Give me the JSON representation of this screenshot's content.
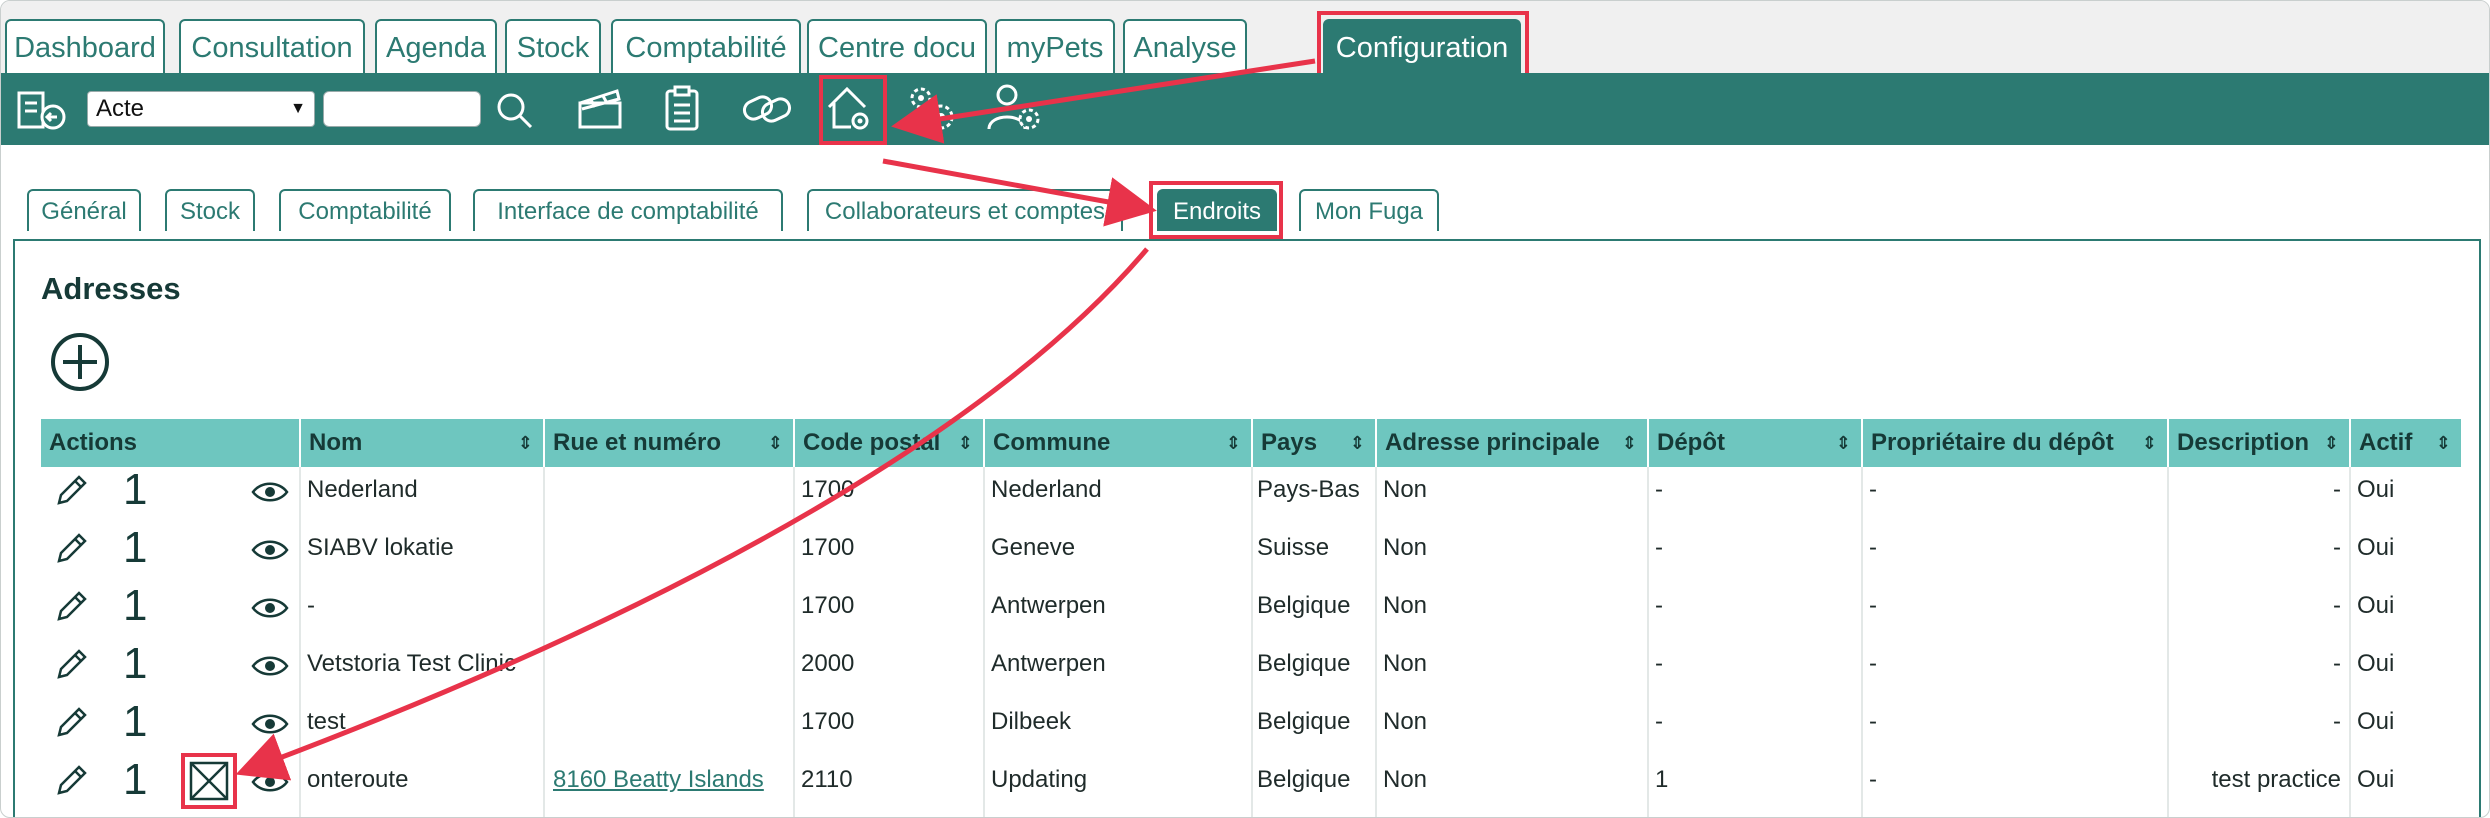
{
  "top_tabs": [
    {
      "label": "Dashboard"
    },
    {
      "label": "Consultation"
    },
    {
      "label": "Agenda"
    },
    {
      "label": "Stock"
    },
    {
      "label": "Comptabilité"
    },
    {
      "label": "Centre docu"
    },
    {
      "label": "myPets"
    },
    {
      "label": "Analyse"
    },
    {
      "label": "Configuration"
    }
  ],
  "toolbar": {
    "select_value": "Acte",
    "search_value": ""
  },
  "sub_tabs": [
    {
      "label": "Général"
    },
    {
      "label": "Stock"
    },
    {
      "label": "Comptabilité"
    },
    {
      "label": "Interface de comptabilité"
    },
    {
      "label": "Collaborateurs et comptes"
    },
    {
      "label": "Endroits"
    },
    {
      "label": "Mon Fuga"
    }
  ],
  "section_title": "Adresses",
  "table": {
    "headers": [
      "Actions",
      "Nom",
      "Rue et numéro",
      "Code postal",
      "Commune",
      "Pays",
      "Adresse principale",
      "Dépôt",
      "Propriétaire du dépôt",
      "Description",
      "Actif"
    ],
    "rows": [
      {
        "count": "1",
        "nom": "Nederland",
        "rue": "",
        "cp": "1700",
        "commune": "Nederland",
        "pays": "Pays-Bas",
        "principale": "Non",
        "depot": "-",
        "proprietaire": "-",
        "description": "-",
        "actif": "Oui"
      },
      {
        "count": "1",
        "nom": "SIABV lokatie",
        "rue": "",
        "cp": "1700",
        "commune": "Geneve",
        "pays": "Suisse",
        "principale": "Non",
        "depot": "-",
        "proprietaire": "-",
        "description": "-",
        "actif": "Oui"
      },
      {
        "count": "1",
        "nom": "-",
        "rue": "",
        "cp": "1700",
        "commune": "Antwerpen",
        "pays": "Belgique",
        "principale": "Non",
        "depot": "-",
        "proprietaire": "-",
        "description": "-",
        "actif": "Oui"
      },
      {
        "count": "1",
        "nom": "Vetstoria Test Clinic",
        "rue": "",
        "cp": "2000",
        "commune": "Antwerpen",
        "pays": "Belgique",
        "principale": "Non",
        "depot": "-",
        "proprietaire": "-",
        "description": "-",
        "actif": "Oui"
      },
      {
        "count": "1",
        "nom": "test",
        "rue": "",
        "cp": "1700",
        "commune": "Dilbeek",
        "pays": "Belgique",
        "principale": "Non",
        "depot": "-",
        "proprietaire": "-",
        "description": "-",
        "actif": "Oui"
      },
      {
        "count": "1",
        "nom": "onteroute",
        "rue": "8160 Beatty Islands",
        "cp": "2110",
        "commune": "Updating",
        "pays": "Belgique",
        "principale": "Non",
        "depot": "1",
        "proprietaire": "-",
        "description": "test practice",
        "actif": "Oui"
      }
    ]
  },
  "colors": {
    "accent": "#2c7a72",
    "header_bg": "#6ec6bf",
    "annotation": "#e8334a"
  },
  "icons": [
    "back-list-icon",
    "search-icon",
    "clapperboard-icon",
    "clipboard-icon",
    "link-icon",
    "home-settings-icon",
    "gears-icon",
    "user-settings-icon",
    "add-circle-icon",
    "pencil-icon",
    "eye-icon",
    "delete-x-icon"
  ]
}
